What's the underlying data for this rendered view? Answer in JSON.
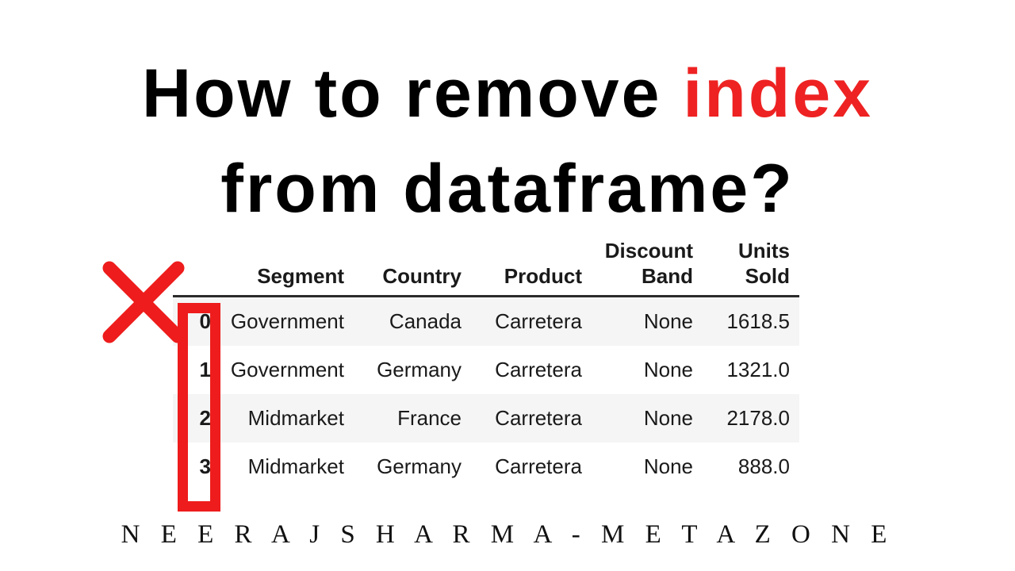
{
  "title": {
    "line1_prefix": "How to remove ",
    "line1_accent": "index",
    "line2": "from dataframe?",
    "accent_color": "#ee2222"
  },
  "annotations": {
    "x_mark": "x-mark",
    "index_highlight_box": "index-column-highlight",
    "color": "#ee1c1c"
  },
  "table": {
    "index_header": "",
    "columns": [
      "Segment",
      "Country",
      "Product",
      "Discount Band",
      "Units Sold"
    ],
    "index": [
      "0",
      "1",
      "2",
      "3"
    ],
    "rows": [
      [
        "Government",
        "Canada",
        "Carretera",
        "None",
        "1618.5"
      ],
      [
        "Government",
        "Germany",
        "Carretera",
        "None",
        "1321.0"
      ],
      [
        "Midmarket",
        "France",
        "Carretera",
        "None",
        "2178.0"
      ],
      [
        "Midmarket",
        "Germany",
        "Carretera",
        "None",
        "888.0"
      ]
    ],
    "stripe_color": "#f5f5f5",
    "base_color": "#ffffff"
  },
  "caption": "N E E R A J   S H A R M A   -   M E T A Z O N E"
}
